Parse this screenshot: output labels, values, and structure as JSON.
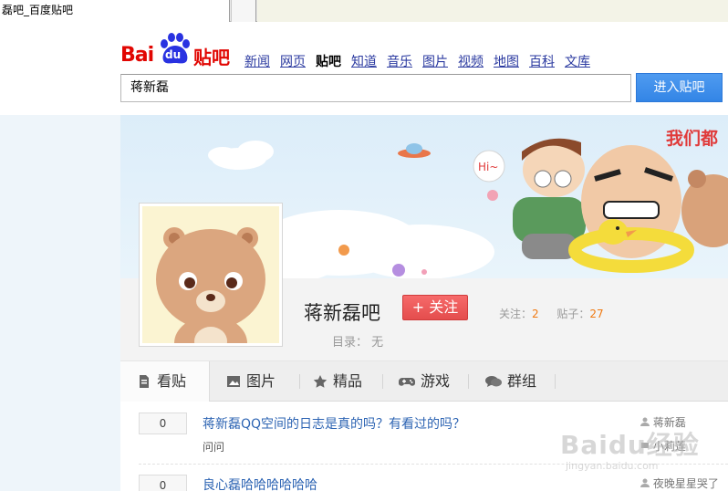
{
  "browser": {
    "tab_title": "磊吧_百度贴吧"
  },
  "header": {
    "logo_text_bai": "Bai",
    "logo_text_du": "du",
    "logo_text_tieba": "贴吧",
    "nav": [
      {
        "label": "新闻",
        "active": false
      },
      {
        "label": "网页",
        "active": false
      },
      {
        "label": "贴吧",
        "active": true
      },
      {
        "label": "知道",
        "active": false
      },
      {
        "label": "音乐",
        "active": false
      },
      {
        "label": "图片",
        "active": false
      },
      {
        "label": "视频",
        "active": false
      },
      {
        "label": "地图",
        "active": false
      },
      {
        "label": "百科",
        "active": false
      },
      {
        "label": "文库",
        "active": false
      }
    ],
    "search_value": "蒋新磊",
    "enter_button": "进入贴吧"
  },
  "banner": {
    "slogan": "我们都",
    "hi_bubble": "Hi~"
  },
  "forum": {
    "name": "蒋新磊吧",
    "follow_button": "+ 关注",
    "follow_label": "关注：",
    "follow_count": "2",
    "posts_label": "贴子：",
    "posts_count": "27",
    "catalog_label": "目录：",
    "catalog_value": "无"
  },
  "tabs": [
    {
      "label": "看贴",
      "icon": "document-icon",
      "active": true
    },
    {
      "label": "图片",
      "icon": "image-icon",
      "active": false
    },
    {
      "label": "精品",
      "icon": "star-icon",
      "active": false
    },
    {
      "label": "游戏",
      "icon": "gamepad-icon",
      "active": false
    },
    {
      "label": "群组",
      "icon": "chat-icon",
      "active": false
    }
  ],
  "posts": [
    {
      "count": "0",
      "title": "蒋新磊QQ空间的日志是真的吗？有看过的吗？",
      "desc": "问问",
      "author": "蒋新磊",
      "author2": "小莉莲"
    },
    {
      "count": "0",
      "title": "良心磊哈哈哈哈哈哈",
      "desc": "",
      "author": "夜晚星星哭了"
    }
  ],
  "watermark": {
    "text": "Baidu经验",
    "sub": "jingyan.baidu.com"
  },
  "colors": {
    "brand_red": "#e10602",
    "link_blue": "#2d64b3",
    "button_blue": "#3385e6",
    "follow_red": "#e44d4d",
    "stat_orange": "#f07a12"
  }
}
